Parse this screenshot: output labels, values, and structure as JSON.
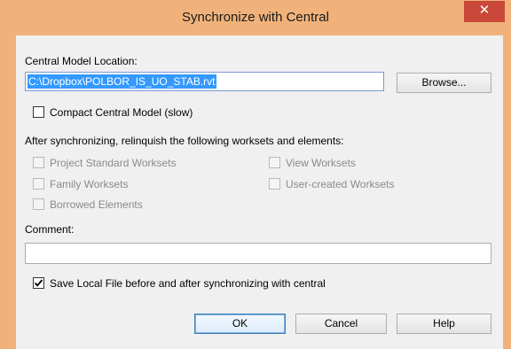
{
  "window": {
    "title": "Synchronize with Central",
    "close_label": "✕"
  },
  "central": {
    "label": "Central Model Location:",
    "path": "C:\\Dropbox\\POLBOR_IS_UO_STAB.rvt",
    "browse_label": "Browse..."
  },
  "compact": {
    "label": "Compact Central Model (slow)",
    "checked": false
  },
  "relinquish": {
    "label": "After synchronizing, relinquish the following worksets and elements:",
    "items": [
      {
        "label": "Project Standard Worksets",
        "checked": false,
        "enabled": false
      },
      {
        "label": "View Worksets",
        "checked": false,
        "enabled": false
      },
      {
        "label": "Family Worksets",
        "checked": false,
        "enabled": false
      },
      {
        "label": "User-created Worksets",
        "checked": false,
        "enabled": false
      },
      {
        "label": "Borrowed Elements",
        "checked": false,
        "enabled": false
      }
    ]
  },
  "comment": {
    "label": "Comment:",
    "value": ""
  },
  "save_local": {
    "label": "Save Local File before and after synchronizing with central",
    "checked": true
  },
  "buttons": {
    "ok": "OK",
    "cancel": "Cancel",
    "help": "Help"
  },
  "colors": {
    "titlebar": "#f0b27a",
    "close": "#c9483a",
    "selection": "#3399ff"
  }
}
